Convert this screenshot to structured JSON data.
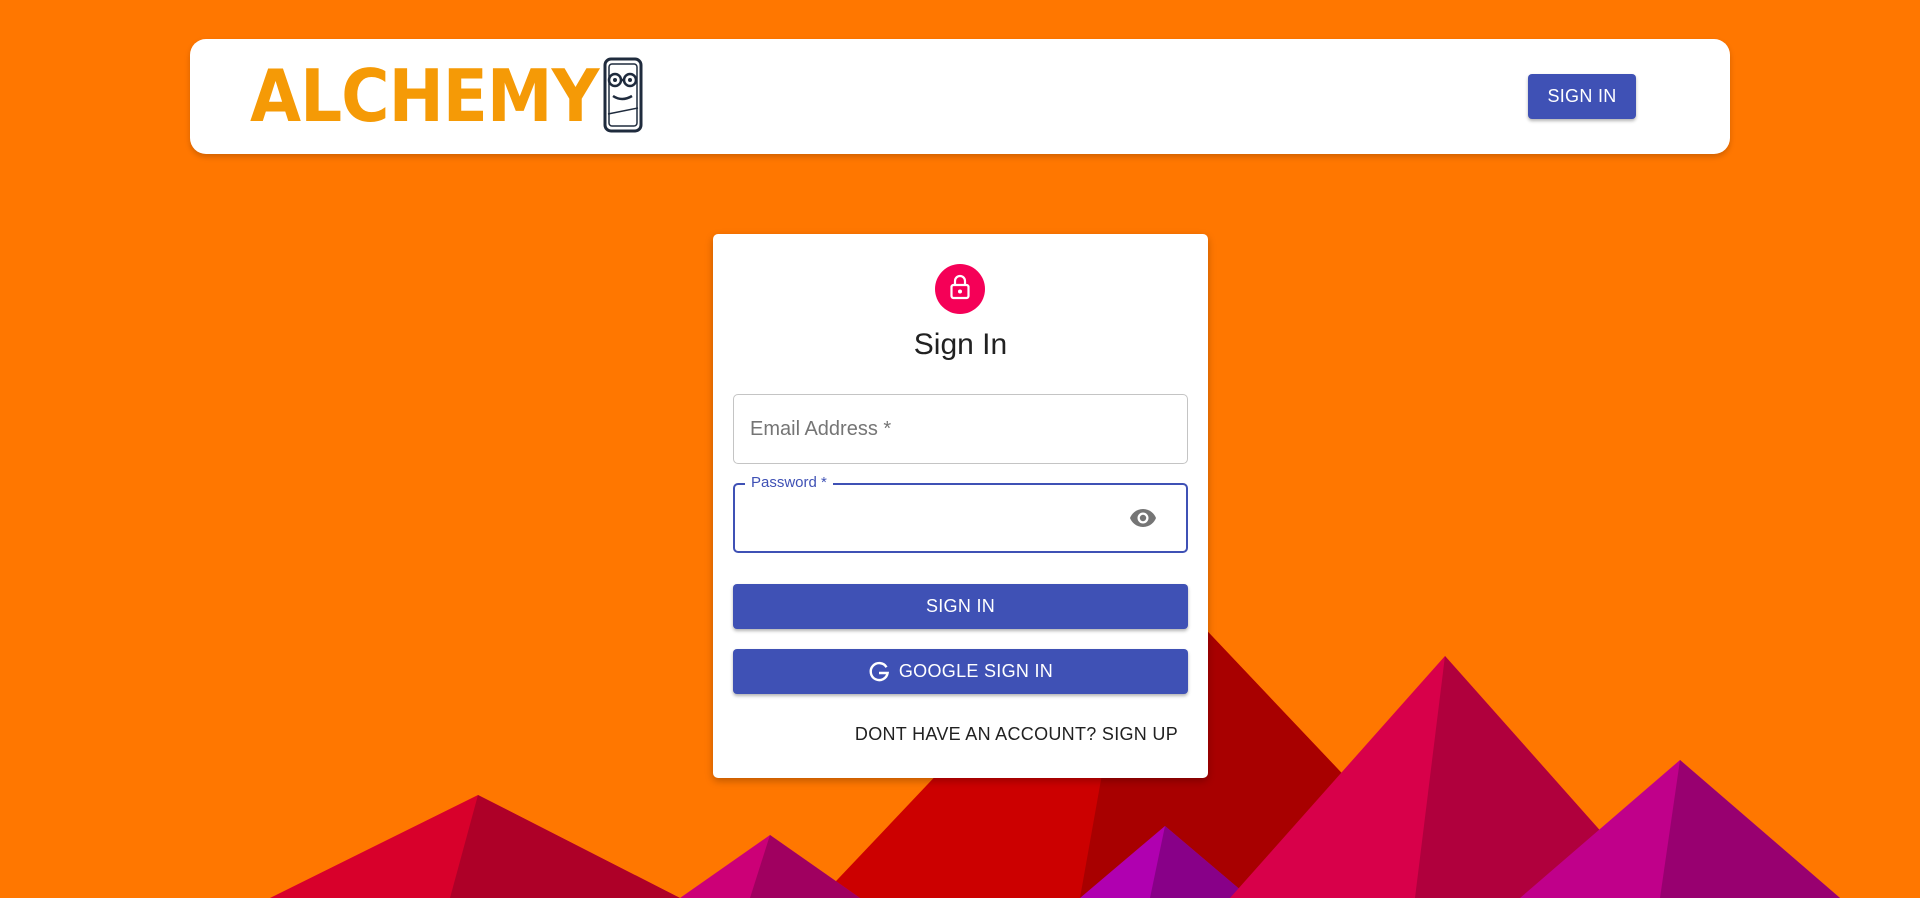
{
  "colors": {
    "background": "#ff7700",
    "accent": "#3f51b5",
    "lock_avatar": "#f50057",
    "logo": "#f59a06"
  },
  "header": {
    "logo_text": "ALCHEMY",
    "logo_icon": "phone-mascot-icon",
    "signin_label": "SIGN IN"
  },
  "signin_card": {
    "lock_icon": "lock-icon",
    "title": "Sign In",
    "email": {
      "placeholder": "Email Address *",
      "value": ""
    },
    "password": {
      "label": "Password *",
      "value": "",
      "toggle_icon": "eye-icon"
    },
    "signin_button": "SIGN IN",
    "google_button": "GOOGLE SIGN IN",
    "google_icon": "google-icon",
    "signup_link": "DONT HAVE AN ACCOUNT? SIGN UP"
  }
}
